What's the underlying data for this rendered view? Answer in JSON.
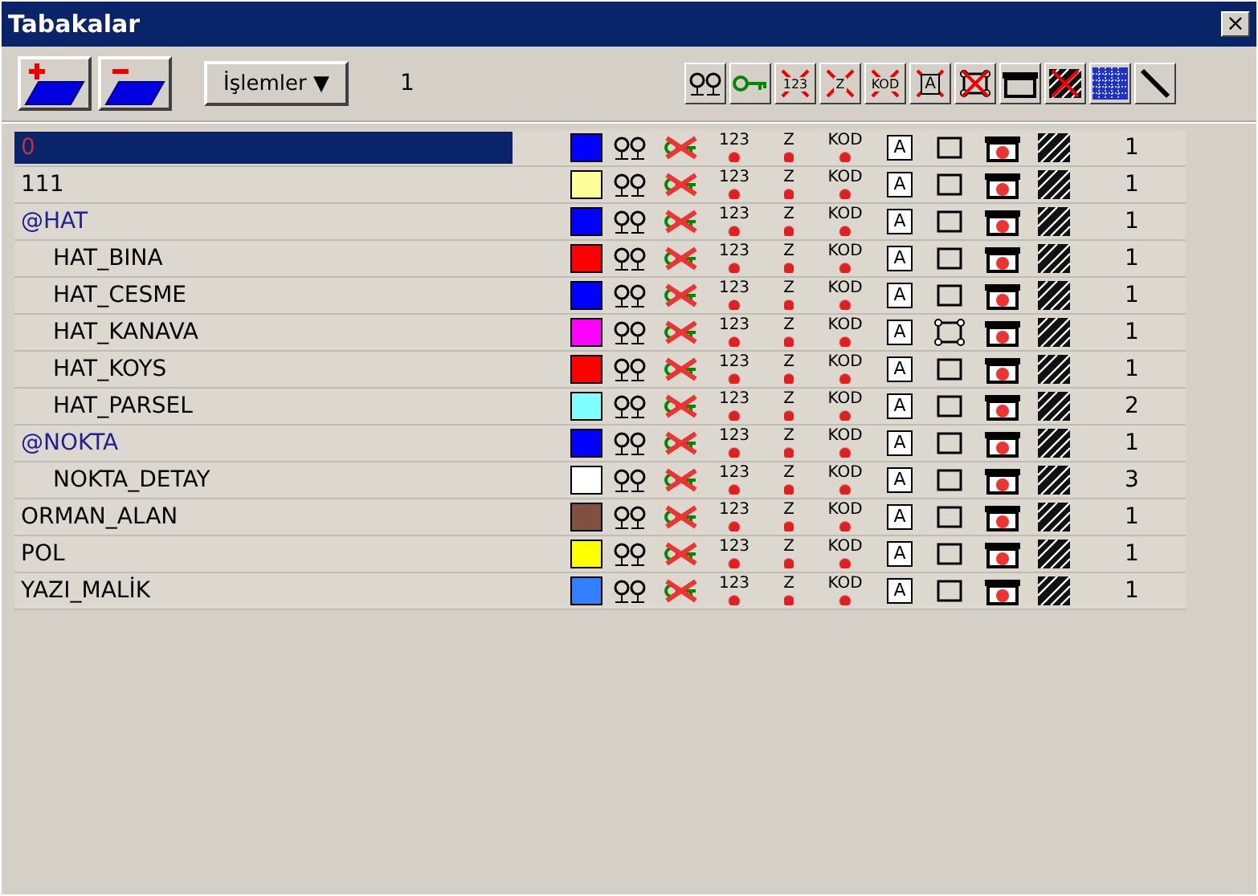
{
  "window": {
    "title": "Tabakalar",
    "close": "×"
  },
  "toolbar": {
    "menu_label": "İşlemler",
    "menu_caret": "▼",
    "count": "1",
    "buttons": [
      {
        "kind": "eyes",
        "crossed": false
      },
      {
        "kind": "key",
        "crossed": false
      },
      {
        "kind": "number",
        "text": "123",
        "crossed": true
      },
      {
        "kind": "z",
        "text": "Z",
        "crossed": true
      },
      {
        "kind": "code",
        "text": "KOD",
        "crossed": true
      },
      {
        "kind": "text",
        "text": "A",
        "crossed": true
      },
      {
        "kind": "frame",
        "crossed": true
      },
      {
        "kind": "printer",
        "crossed": false
      },
      {
        "kind": "hatch",
        "crossed": true
      },
      {
        "kind": "pattern",
        "crossed": false
      },
      {
        "kind": "pen",
        "crossed": false
      }
    ]
  },
  "layers": [
    {
      "name": "0",
      "kind": "layer",
      "selected": true,
      "color": "#0000ff",
      "marks": [
        "123",
        "Z",
        "KOD",
        "A"
      ],
      "frame": {
        "kind": "plain"
      },
      "count": "1"
    },
    {
      "name": "111",
      "kind": "layer",
      "selected": false,
      "color": "#ffff99",
      "marks": [
        "123",
        "Z",
        "KOD",
        "A"
      ],
      "frame": {
        "kind": "plain"
      },
      "count": "1"
    },
    {
      "name": "@HAT",
      "kind": "group",
      "selected": false,
      "color": "#0000ff",
      "marks": [
        "123",
        "Z",
        "KOD",
        "A"
      ],
      "frame": {
        "kind": "plain"
      },
      "count": "1",
      "children": [
        {
          "name": "HAT_BINA",
          "kind": "layer",
          "selected": false,
          "color": "#ff0000",
          "marks": [
            "123",
            "Z",
            "KOD",
            "A"
          ],
          "frame": {
            "kind": "plain"
          },
          "count": "1"
        },
        {
          "name": "HAT_CESME",
          "kind": "layer",
          "selected": false,
          "color": "#0000ff",
          "marks": [
            "123",
            "Z",
            "KOD",
            "A"
          ],
          "frame": {
            "kind": "plain"
          },
          "count": "1"
        },
        {
          "name": "HAT_KANAVA",
          "kind": "layer",
          "selected": false,
          "color": "#ff00ff",
          "marks": [
            "123",
            "Z",
            "KOD",
            "A"
          ],
          "frame": {
            "kind": "corners"
          },
          "count": "1"
        },
        {
          "name": "HAT_KOYS",
          "kind": "layer",
          "selected": false,
          "color": "#ff0000",
          "marks": [
            "123",
            "Z",
            "KOD",
            "A"
          ],
          "frame": {
            "kind": "plain"
          },
          "count": "1"
        },
        {
          "name": "HAT_PARSEL",
          "kind": "layer",
          "selected": false,
          "color": "#80ffff",
          "marks": [
            "123",
            "Z",
            "KOD",
            "A"
          ],
          "frame": {
            "kind": "plain"
          },
          "count": "2"
        }
      ]
    },
    {
      "name": "@NOKTA",
      "kind": "group",
      "selected": false,
      "color": "#0000ff",
      "marks": [
        "123",
        "Z",
        "KOD",
        "A"
      ],
      "frame": {
        "kind": "plain"
      },
      "count": "1",
      "children": [
        {
          "name": "NOKTA_DETAY",
          "kind": "layer",
          "selected": false,
          "color": "#ffffff",
          "marks": [
            "123",
            "Z",
            "KOD",
            "A"
          ],
          "frame": {
            "kind": "plain"
          },
          "count": "3"
        }
      ]
    },
    {
      "name": "ORMAN_ALAN",
      "kind": "layer",
      "selected": false,
      "color": "#805040",
      "marks": [
        "123",
        "Z",
        "KOD",
        "A"
      ],
      "frame": {
        "kind": "plain"
      },
      "count": "1"
    },
    {
      "name": "POL",
      "kind": "layer",
      "selected": false,
      "color": "#ffff00",
      "marks": [
        "123",
        "Z",
        "KOD",
        "A"
      ],
      "frame": {
        "kind": "plain"
      },
      "count": "1"
    },
    {
      "name": "YAZI_MALİK",
      "kind": "layer",
      "selected": false,
      "color": "#3080ff",
      "marks": [
        "123",
        "Z",
        "KOD",
        "A"
      ],
      "frame": {
        "kind": "plain"
      },
      "count": "1"
    }
  ]
}
